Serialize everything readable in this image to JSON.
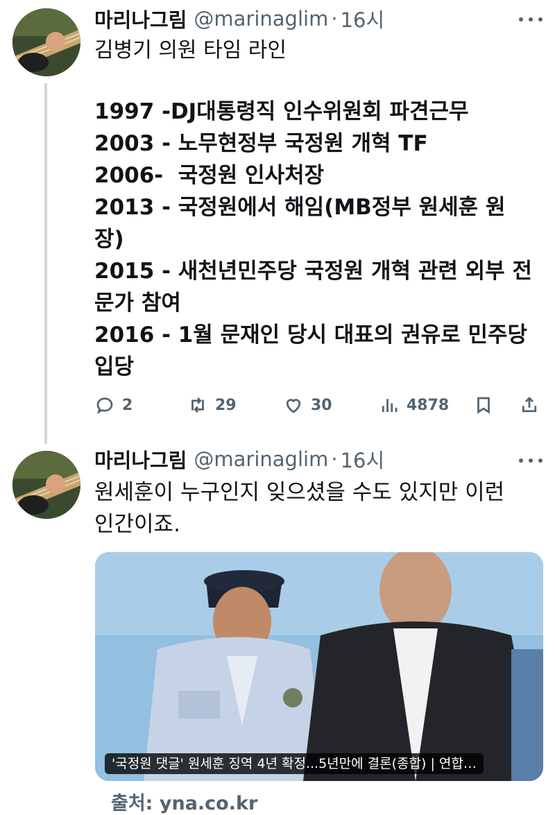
{
  "tweets": [
    {
      "author_name": "마리나그림",
      "handle": "@marinaglim",
      "separator": "·",
      "time": "16시",
      "title": "김병기 의원 타임 라인",
      "timeline": [
        "1997 -DJ대통령직 인수위원회 파견근무",
        "2003 - 노무현정부 국정원 개혁 TF",
        "2006-  국정원 인사처장",
        "2013 - 국정원에서 해임(MB정부 원세훈 원\n장)",
        "2015 - 새천년민주당 국정원 개혁 관련 외부 전\n문가 참여",
        "2016 - 1월 문재인 당시 대표의 권유로 민주당\n입당"
      ],
      "stats": {
        "replies": "2",
        "retweets": "29",
        "likes": "30",
        "views": "4878"
      }
    },
    {
      "author_name": "마리나그림",
      "handle": "@marinaglim",
      "separator": "·",
      "time": "16시",
      "text": "원세훈이 누구인지 잊으셨을 수도 있지만 이런\n인간이죠.",
      "media_caption": "'국정원 댓글' 원세훈 징역 4년 확정...5년만에 결론(종합) | 연합…",
      "source_label": "출처: yna.co.kr"
    }
  ],
  "icons": [
    "more-icon",
    "reply-icon",
    "retweet-icon",
    "like-icon",
    "views-icon",
    "bookmark-icon",
    "share-icon"
  ],
  "colors": {
    "text": "#0f1419",
    "secondary": "#536471",
    "thread_line": "#cfd9de"
  }
}
